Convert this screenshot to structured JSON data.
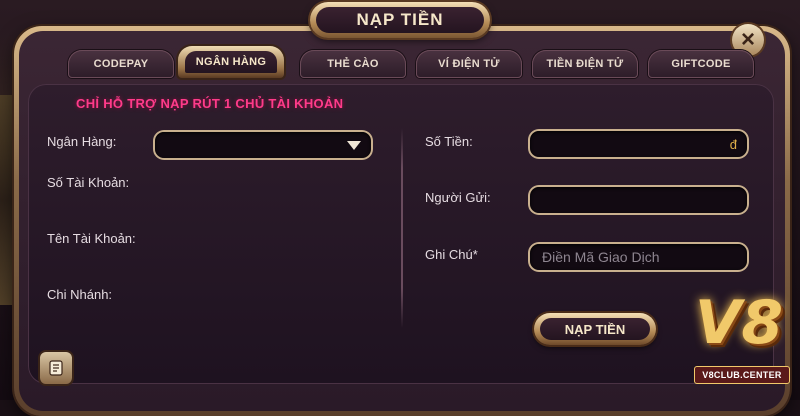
{
  "title": "NẠP TIỀN",
  "close_symbol": "×",
  "tabs": [
    {
      "label": "CODEPAY",
      "active": false
    },
    {
      "label": "NGÂN HÀNG",
      "active": true
    },
    {
      "label": "THẺ CÀO",
      "active": false
    },
    {
      "label": "VÍ ĐIỆN TỬ",
      "active": false
    },
    {
      "label": "TIỀN ĐIỆN TỬ",
      "active": false
    },
    {
      "label": "GIFTCODE",
      "active": false
    }
  ],
  "notice": "CHỈ HỖ TRỢ NẠP RÚT 1 CHỦ TÀI KHOẢN",
  "left_form": {
    "bank_label": "Ngân Hàng:",
    "bank_value": "",
    "account_number_label": "Số Tài Khoản:",
    "account_number_value": "",
    "account_name_label": "Tên Tài Khoản:",
    "account_name_value": "",
    "branch_label": "Chi Nhánh:",
    "branch_value": ""
  },
  "right_form": {
    "amount_label": "Số Tiền:",
    "amount_value": "",
    "currency_symbol": "đ",
    "sender_label": "Người Gửi:",
    "sender_value": "",
    "note_label": "Ghi Chú*",
    "note_placeholder": "Điền Mã Giao Dịch"
  },
  "submit_label": "NẠP TIỀN",
  "logo": {
    "main": "V8",
    "sub": "V8CLUB.CENTER"
  },
  "icons": {
    "close": "close-icon",
    "dropdown": "chevron-down-icon",
    "corner": "scroll-icon"
  },
  "colors": {
    "accent_gold": "#c9b08e",
    "notice_pink": "#ff3b8a",
    "panel_bg": "#2a1a28"
  }
}
